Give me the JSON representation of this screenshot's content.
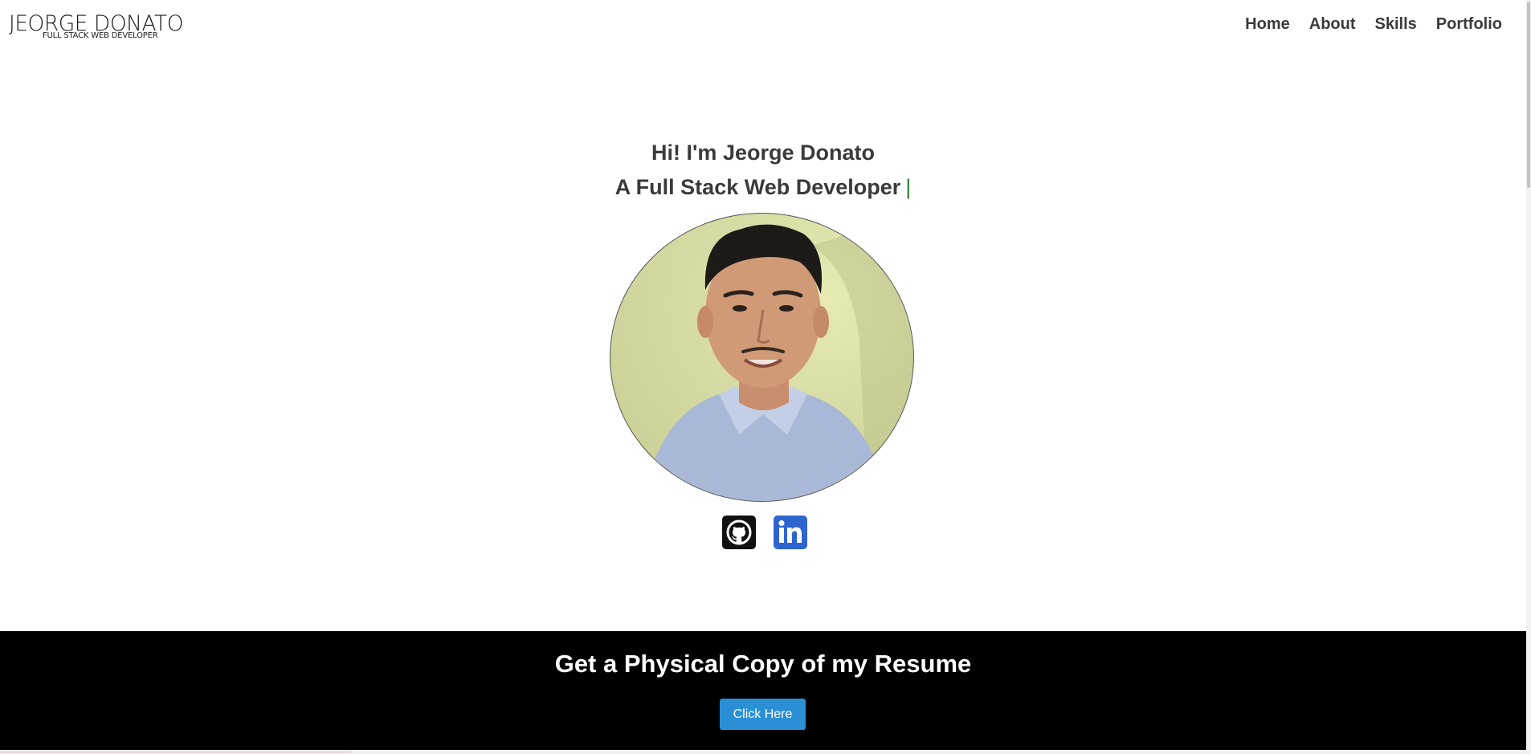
{
  "header": {
    "logo": {
      "name": "JEORGE DONATO",
      "tagline": "FULL STACK WEB DEVELOPER"
    },
    "nav": [
      {
        "label": "Home"
      },
      {
        "label": "About"
      },
      {
        "label": "Skills"
      },
      {
        "label": "Portfolio"
      }
    ]
  },
  "hero": {
    "greeting": "Hi! I'm Jeorge Donato",
    "role": "A Full Stack Web Developer",
    "cursor": "|",
    "photo_alt": "Portrait photo of Jeorge Donato",
    "socials": [
      {
        "name": "GitHub",
        "icon": "github-icon"
      },
      {
        "name": "LinkedIn",
        "icon": "linkedin-icon",
        "text": "in"
      }
    ]
  },
  "resume": {
    "title": "Get a Physical Copy of my Resume",
    "button_label": "Click Here"
  },
  "colors": {
    "resume_band": "#000000",
    "button": "#2b8fd6",
    "linkedin": "#2d64d0",
    "cursor": "#2e7d32",
    "text": "#3a3a3a"
  }
}
